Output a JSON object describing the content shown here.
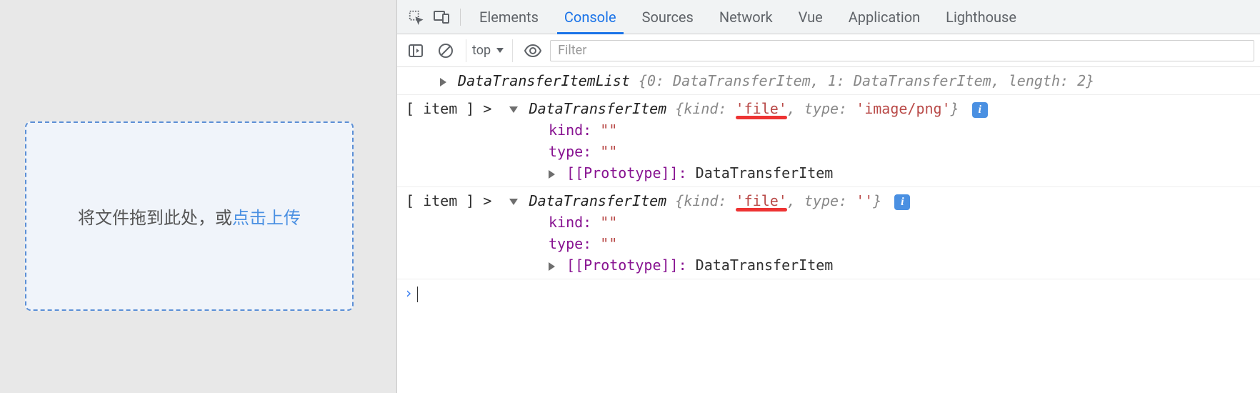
{
  "left": {
    "drag_text": "将文件拖到此处，或",
    "link_text": "点击上传"
  },
  "devtools": {
    "tabs": [
      "Elements",
      "Console",
      "Sources",
      "Network",
      "Vue",
      "Application",
      "Lighthouse"
    ],
    "active_tab": "Console",
    "context_label": "top",
    "filter_placeholder": "Filter"
  },
  "console": {
    "line0": {
      "class_name": "DataTransferItemList",
      "index0": "0",
      "val0": "DataTransferItem",
      "index1": "1",
      "val1": "DataTransferItem",
      "len_key": "length",
      "len_val": "2"
    },
    "item1": {
      "prefix": "[ item ] >",
      "class_name": "DataTransferItem",
      "kind_key": "kind",
      "kind_val": "'file'",
      "type_key": "type",
      "type_val": "'image/png'",
      "exp_kind_label": "kind:",
      "exp_kind_val": "\"\"",
      "exp_type_label": "type:",
      "exp_type_val": "\"\"",
      "proto_label": "[[Prototype]]:",
      "proto_val": "DataTransferItem"
    },
    "item2": {
      "prefix": "[ item ] >",
      "class_name": "DataTransferItem",
      "kind_key": "kind",
      "kind_val": "'file'",
      "type_key": "type",
      "type_val": "''",
      "exp_kind_label": "kind:",
      "exp_kind_val": "\"\"",
      "exp_type_label": "type:",
      "exp_type_val": "\"\"",
      "proto_label": "[[Prototype]]:",
      "proto_val": "DataTransferItem"
    },
    "prompt": "›"
  }
}
